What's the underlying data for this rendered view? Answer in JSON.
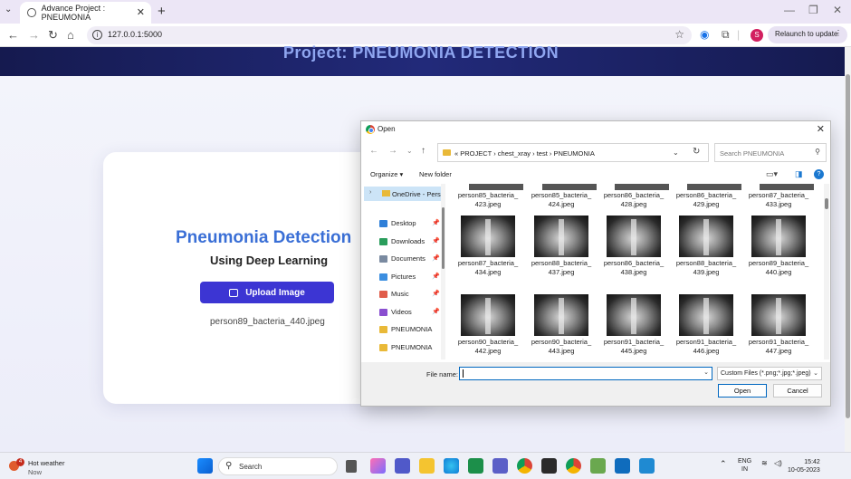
{
  "browser": {
    "tab_title": "Advance Project : PNEUMONIA",
    "url": "127.0.0.1:5000",
    "relaunch_label": "Relaunch to update",
    "profile_initial": "S"
  },
  "page": {
    "header_title": "Project: PNEUMONIA DETECTION",
    "card_title": "Pneumonia Detection",
    "card_subtitle": "Using Deep Learning",
    "upload_label": "Upload Image",
    "selected_filename": "person89_bacteria_440.jpeg"
  },
  "dialog": {
    "title": "Open",
    "breadcrumb": "« PROJECT  ›  chest_xray  ›  test  ›  PNEUMONIA",
    "search_placeholder": "Search PNEUMONIA",
    "organize_label": "Organize ▾",
    "new_folder_label": "New folder",
    "help_label": "?",
    "nav_onedrive": "OneDrive - Perso",
    "nav_items": [
      {
        "label": "Desktop",
        "color": "#2f7fd8",
        "pinned": true
      },
      {
        "label": "Downloads",
        "color": "#2a9d5c",
        "pinned": true
      },
      {
        "label": "Documents",
        "color": "#7a8aa0",
        "pinned": true
      },
      {
        "label": "Pictures",
        "color": "#3b8ee0",
        "pinned": true
      },
      {
        "label": "Music",
        "color": "#e05c4a",
        "pinned": true
      },
      {
        "label": "Videos",
        "color": "#8a4fd0",
        "pinned": true
      },
      {
        "label": "PNEUMONIA",
        "color": "#e9b938",
        "pinned": false
      },
      {
        "label": "PNEUMONIA",
        "color": "#e9b938",
        "pinned": false
      }
    ],
    "files_row1": [
      [
        "person85_bacteria_",
        "423.jpeg"
      ],
      [
        "person85_bacteria_",
        "424.jpeg"
      ],
      [
        "person86_bacteria_",
        "428.jpeg"
      ],
      [
        "person86_bacteria_",
        "429.jpeg"
      ],
      [
        "person87_bacteria_",
        "433.jpeg"
      ]
    ],
    "files_row2": [
      [
        "person87_bacteria_",
        "434.jpeg"
      ],
      [
        "person88_bacteria_",
        "437.jpeg"
      ],
      [
        "person86_bacteria_",
        "438.jpeg"
      ],
      [
        "person88_bacteria_",
        "439.jpeg"
      ],
      [
        "person89_bacteria_",
        "440.jpeg"
      ]
    ],
    "files_row3": [
      [
        "person90_bacteria_",
        "442.jpeg"
      ],
      [
        "person90_bacteria_",
        "443.jpeg"
      ],
      [
        "person91_bacteria_",
        "445.jpeg"
      ],
      [
        "person91_bacteria_",
        "446.jpeg"
      ],
      [
        "person91_bacteria_",
        "447.jpeg"
      ]
    ],
    "filename_label": "File name:",
    "filename_value": "",
    "filetype": "Custom Files (*.png;*.jpg;*.jpeg)",
    "open_label": "Open",
    "cancel_label": "Cancel"
  },
  "taskbar": {
    "weather_title": "Hot weather",
    "weather_sub": "Now",
    "weather_badge": "4",
    "search_label": "Search",
    "lang_1": "ENG",
    "lang_2": "IN",
    "time": "15:42",
    "date": "10-05-2023"
  }
}
